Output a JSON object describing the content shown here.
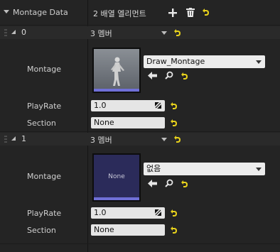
{
  "montage_data": {
    "label": "Montage Data",
    "count_text": "2 배열 엘리먼트"
  },
  "elements": [
    {
      "index": "0",
      "members_text": "3 멤버",
      "montage_label": "Montage",
      "asset_value": "Draw_Montage",
      "thumb_text": "",
      "playrate_label": "PlayRate",
      "playrate_value": "1.0",
      "section_label": "Section",
      "section_value": "None"
    },
    {
      "index": "1",
      "members_text": "3 멤버",
      "montage_label": "Montage",
      "asset_value": "없음",
      "thumb_text": "None",
      "playrate_label": "PlayRate",
      "playrate_value": "1.0",
      "section_label": "Section",
      "section_value": "None"
    }
  ],
  "colors": {
    "background": "#242424",
    "reset_yellow": "#e8d21c",
    "thumb_none": "#2b2b5a",
    "thumb_bar": "#7070d8"
  }
}
